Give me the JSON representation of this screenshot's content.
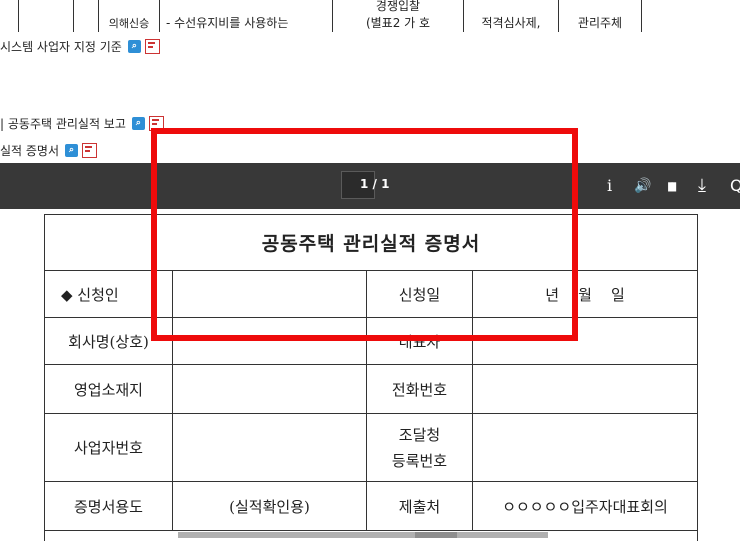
{
  "top_table": {
    "cells": [
      "",
      "",
      "의해신승",
      "- 수선유지비를 사용하는",
      "경쟁입찰\n(별표2 가 호",
      "적격심사제,",
      "관리주체"
    ]
  },
  "files": [
    {
      "label": "시스템 사업자 지정 기준"
    },
    {
      "label": "| 공동주택 관리실적 보고"
    },
    {
      "label": "실적 증명서"
    }
  ],
  "viewer": {
    "page_indicator": "1 / 1",
    "tools": [
      "i",
      "🔊",
      "▮▮",
      "⤓",
      "Q"
    ]
  },
  "certificate": {
    "title": "공동주택 관리실적 증명서",
    "rows": [
      {
        "label": "◆ 신청인",
        "value": "",
        "label2": "신청일",
        "value2": "년    월    일"
      },
      {
        "label": "회사명(상호)",
        "value": "",
        "label2": "대표자",
        "value2": ""
      },
      {
        "label": "영업소재지",
        "value": "",
        "label2": "전화번호",
        "value2": ""
      },
      {
        "label": "사업자번호",
        "value": "",
        "label2": "조달청\n등록번호",
        "value2": ""
      },
      {
        "label": "증명서용도",
        "value": "(실적확인용)",
        "label2": "제출처",
        "value2": "ㅇㅇㅇㅇㅇ입주자대표회의"
      }
    ]
  },
  "colors": {
    "highlight": "#ee0b0b",
    "toolbar": "#383838"
  }
}
